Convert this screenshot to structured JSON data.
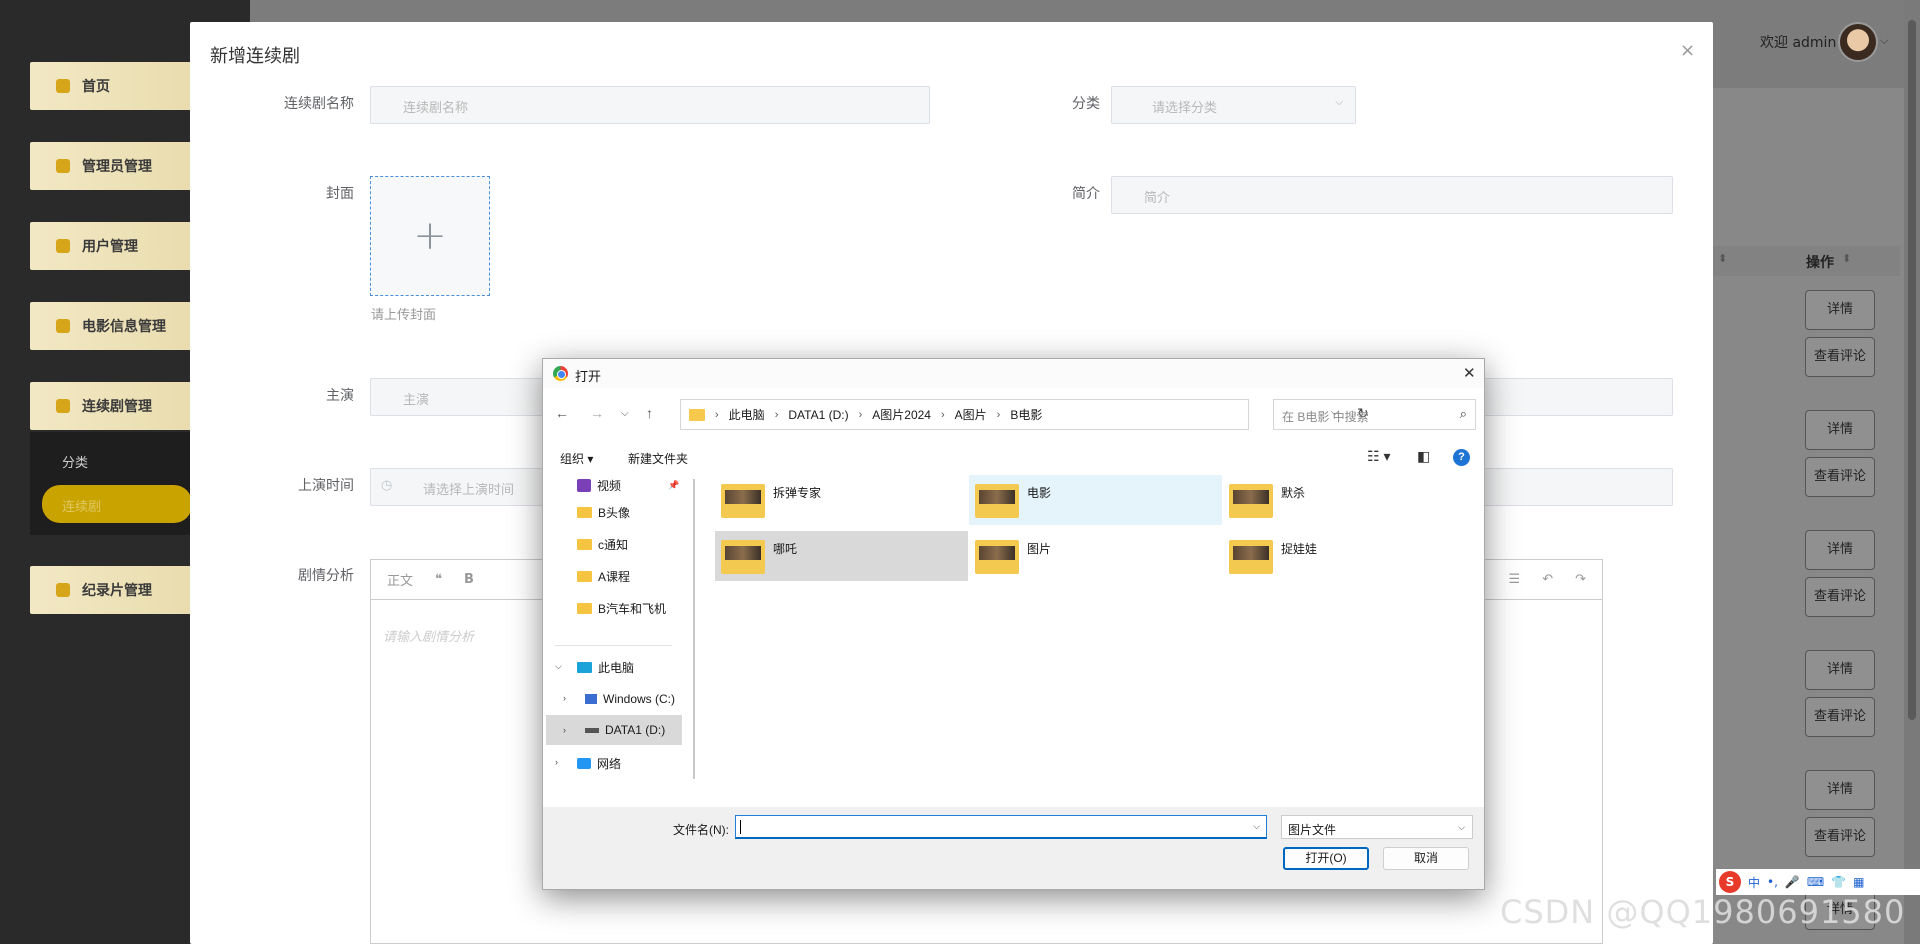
{
  "app": {
    "nav": [
      "首页",
      "管理员管理",
      "用户管理",
      "电影信息管理",
      "连续剧管理",
      "纪录片管理"
    ],
    "nav_sub": [
      "分类",
      "连续剧"
    ],
    "welcome": "欢迎 admin",
    "table": {
      "op_header": "操作",
      "btn_detail": "详情",
      "btn_comment": "查看评论"
    }
  },
  "modal": {
    "title": "新增连续剧",
    "close": "×",
    "fields": {
      "name_label": "连续剧名称",
      "name_placeholder": "连续剧名称",
      "category_label": "分类",
      "category_placeholder": "请选择分类",
      "cover_label": "封面",
      "cover_hint": "请上传封面",
      "intro_label": "简介",
      "intro_placeholder": "简介",
      "actor_label": "主演",
      "actor_placeholder": "主演",
      "date_label": "上演时间",
      "date_placeholder": "请选择上演时间",
      "plot_label": "剧情分析",
      "plot_placeholder": "请输入剧情分析"
    },
    "editor_toolbar": {
      "para": "正文",
      "quote": "❝",
      "bold": "B"
    }
  },
  "dialog": {
    "title": "打开",
    "breadcrumb": [
      "此电脑",
      "DATA1 (D:)",
      "A图片2024",
      "A图片",
      "B电影"
    ],
    "search_placeholder": "在 B电影 中搜索",
    "cmd": {
      "organize": "组织 ▾",
      "new_folder": "新建文件夹"
    },
    "tree": {
      "quick": [
        "视频",
        "B头像",
        "c通知",
        "A课程",
        "B汽车和飞机"
      ],
      "pc": "此电脑",
      "drive_c": "Windows (C:)",
      "drive_d": "DATA1 (D:)",
      "network": "网络"
    },
    "files": [
      "拆弹专家",
      "电影",
      "默杀",
      "哪吒",
      "图片",
      "捉娃娃"
    ],
    "filename_label": "文件名(N):",
    "filename_value": "",
    "filetype": "图片文件",
    "open_btn": "打开(O)",
    "cancel_btn": "取消"
  },
  "ime": {
    "logo": "S",
    "mode": "中"
  },
  "watermark": "CSDN @QQ1980691580"
}
